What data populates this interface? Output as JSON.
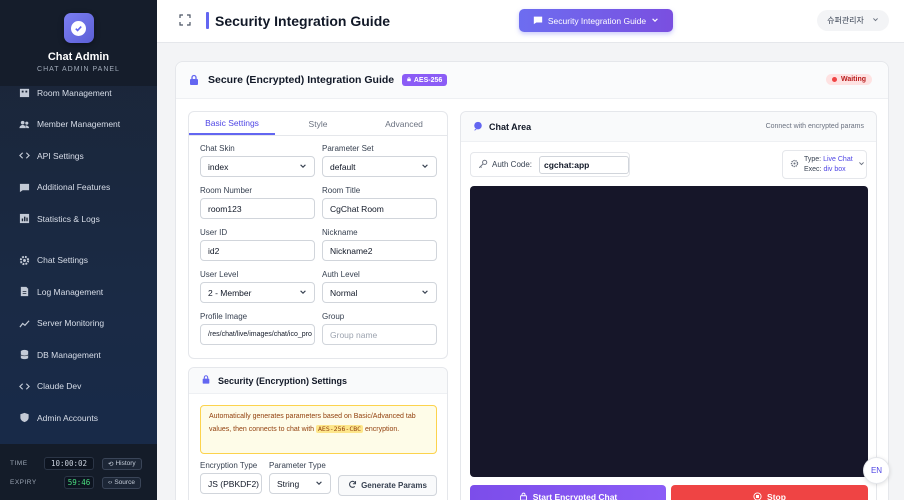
{
  "brand": {
    "title": "Chat Admin",
    "subtitle": "CHAT ADMIN PANEL"
  },
  "sidebar": {
    "items": [
      {
        "label": "Room Management",
        "icon": "building-icon"
      },
      {
        "label": "Member Management",
        "icon": "users-icon"
      },
      {
        "label": "API Settings",
        "icon": "code-icon"
      },
      {
        "label": "Additional Features",
        "icon": "chat-bubble-icon"
      },
      {
        "label": "Statistics & Logs",
        "icon": "chart-icon"
      },
      {
        "label": "Chat Settings",
        "icon": "gear-icon"
      },
      {
        "label": "Log Management",
        "icon": "document-icon"
      },
      {
        "label": "Server Monitoring",
        "icon": "line-chart-icon"
      },
      {
        "label": "DB Management",
        "icon": "database-icon"
      },
      {
        "label": "Claude Dev",
        "icon": "code-icon"
      },
      {
        "label": "Admin Accounts",
        "icon": "shield-icon"
      }
    ],
    "footer": {
      "time_label": "TIME",
      "time_value": "10:00:02",
      "history_label": "History",
      "expiry_label": "EXPIRY",
      "expiry_value": "59:46",
      "source_label": "Source"
    }
  },
  "topbar": {
    "title": "Security Integration Guide",
    "guide_button": "Security Integration Guide",
    "user": "슈퍼관리자"
  },
  "panel": {
    "title": "Secure (Encrypted) Integration Guide",
    "badge": "AES-256",
    "status": "Waiting"
  },
  "form": {
    "tabs": [
      "Basic Settings",
      "Style",
      "Advanced"
    ],
    "fields": {
      "chat_skin": {
        "label": "Chat Skin",
        "value": "index"
      },
      "parameter_set": {
        "label": "Parameter Set",
        "value": "default"
      },
      "room_number": {
        "label": "Room Number",
        "value": "room123"
      },
      "room_title": {
        "label": "Room Title",
        "value": "CgChat Room"
      },
      "user_id": {
        "label": "User ID",
        "value": "id2"
      },
      "nickname": {
        "label": "Nickname",
        "value": "Nickname2"
      },
      "user_level": {
        "label": "User Level",
        "value": "2 - Member"
      },
      "auth_level": {
        "label": "Auth Level",
        "value": "Normal"
      },
      "profile_image": {
        "label": "Profile Image",
        "value": "/res/chat/live/images/chat/ico_pro"
      },
      "group": {
        "label": "Group",
        "placeholder": "Group name"
      }
    }
  },
  "security": {
    "title": "Security (Encryption) Settings",
    "notice_before": "Automatically generates parameters based on Basic/Advanced tab values, then connects to chat with",
    "notice_code": "AES-256-CBC",
    "notice_after": "encryption.",
    "encryption_type_label": "Encryption Type",
    "encryption_type_value": "JS (PBKDF2)",
    "parameter_type_label": "Parameter Type",
    "parameter_type_value": "String",
    "generate_button": "Generate Params"
  },
  "chat": {
    "title": "Chat Area",
    "note": "Connect with encrypted params",
    "auth_label": "Auth Code:",
    "auth_value": "cgchat:app",
    "type_label": "Type:",
    "type_value": "Live Chat",
    "exec_label": "Exec:",
    "exec_value": "div box",
    "start_button": "Start Encrypted Chat",
    "stop_button": "Stop"
  },
  "lang": "EN",
  "colors": {
    "accent": "#6366f1",
    "purple": "#8b5cf6",
    "danger": "#ef4444",
    "success": "#4ade80"
  }
}
